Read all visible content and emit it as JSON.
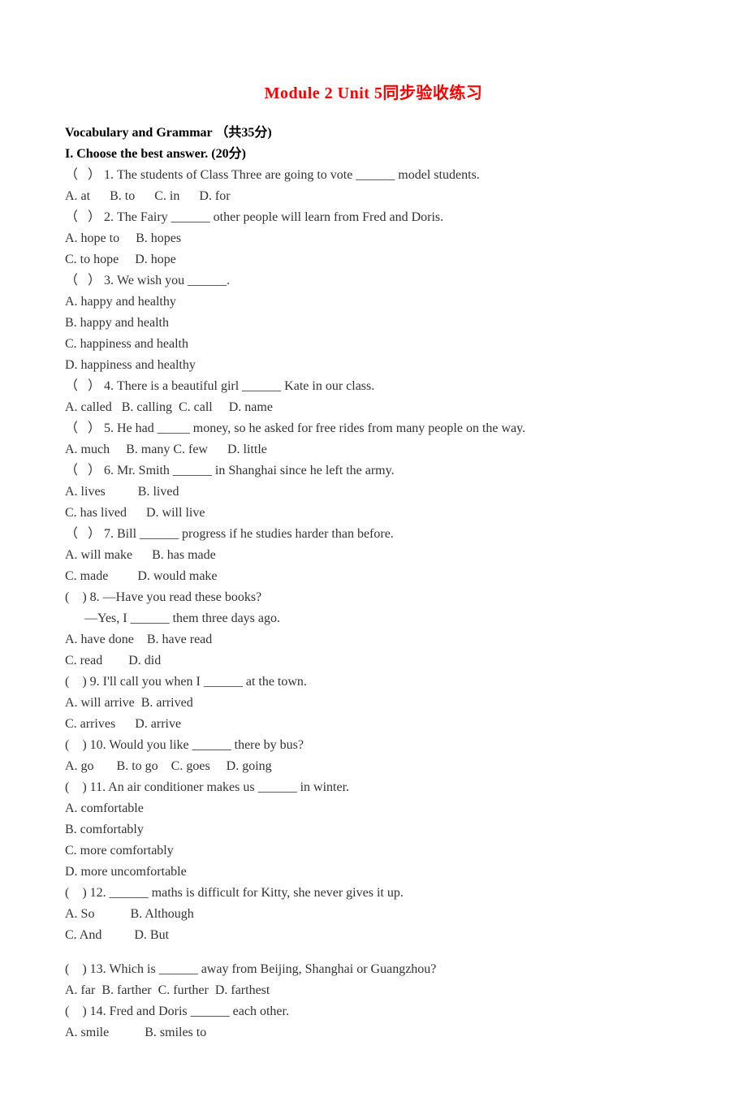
{
  "title": {
    "main": "Module 2 Unit 5",
    "suffix": "同步验收练习"
  },
  "section_header": "Vocabulary and Grammar （共35分)",
  "sub_header": "I. Choose the best answer. (20分)",
  "q1": {
    "text": "（   ） 1. The students of Class Three are going to vote ______ model students.",
    "opts": "A. at      B. to      C. in      D. for"
  },
  "q2": {
    "text": "（   ） 2. The Fairy ______ other people will learn from Fred and Doris.",
    "optA": "A. hope to     B. hopes",
    "optB": "C. to hope     D. hope"
  },
  "q3": {
    "text": "（   ） 3. We wish you ______.",
    "a": "A. happy and healthy",
    "b": "B. happy and health",
    "c": "C. happiness and health",
    "d": "D. happiness and healthy"
  },
  "q4": {
    "text": "（   ） 4. There is a beautiful girl ______ Kate in our class.",
    "opts": "A. called   B. calling  C. call     D. name"
  },
  "q5": {
    "text": "（   ） 5. He had _____ money, so he asked for free rides from many people on the way.",
    "opts": "A. much     B. many C. few      D. little"
  },
  "q6": {
    "text": "（   ） 6. Mr. Smith ______ in Shanghai since he left the army.",
    "optA": "A. lives          B. lived",
    "optB": "C. has lived      D. will live"
  },
  "q7": {
    "text": "（   ） 7. Bill ______ progress if he studies harder than before.",
    "optA": "A. will make      B. has made",
    "optB": "C. made         D. would make"
  },
  "q8": {
    "text": "(    ) 8. —Have you read these books?",
    "text2": "      —Yes, I ______ them three days ago.",
    "optA": "A. have done    B. have read",
    "optB": "C. read        D. did"
  },
  "q9": {
    "text": "(    ) 9. I'll call you when I ______ at the town.",
    "optA": "A. will arrive  B. arrived",
    "optB": "C. arrives      D. arrive"
  },
  "q10": {
    "text": "(    ) 10. Would you like ______ there by bus?",
    "opts": "A. go       B. to go    C. goes     D. going"
  },
  "q11": {
    "text": "(    ) 11. An air conditioner makes us ______ in winter.",
    "a": "A. comfortable",
    "b": "B. comfortably",
    "c": "C. more comfortably",
    "d": "D. more uncomfortable"
  },
  "q12": {
    "text": "(    ) 12. ______ maths is difficult for Kitty, she never gives it up.",
    "optA": "A. So           B. Although",
    "optB": "C. And          D. But"
  },
  "q13": {
    "text": "(    ) 13. Which is ______ away from Beijing, Shanghai or Guangzhou?",
    "opts": "A. far  B. farther  C. further  D. farthest"
  },
  "q14": {
    "text": "(    ) 14. Fred and Doris ______ each other.",
    "optA": "A. smile           B. smiles to"
  }
}
